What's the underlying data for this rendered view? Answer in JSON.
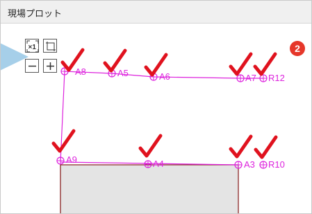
{
  "window": {
    "title": "現場プロット"
  },
  "toolbar": {
    "fit_label": "×1",
    "frame_icon": "frame-select-icon",
    "zoom_out_label": "−",
    "zoom_in_label": "+"
  },
  "step_badge": "2",
  "points": [
    {
      "label": "A8"
    },
    {
      "label": "A5"
    },
    {
      "label": "A6"
    },
    {
      "label": "A7"
    },
    {
      "label": "R12"
    },
    {
      "label": "A9"
    },
    {
      "label": "A4"
    },
    {
      "label": "A3"
    },
    {
      "label": "R10"
    }
  ],
  "colors": {
    "plot_line": "#dd22dd",
    "checkmark": "#e0121e",
    "building_fill": "#e4e4e4",
    "building_edge": "#8a2525",
    "pointer": "#a6cfe9",
    "badge": "#e6372a"
  }
}
